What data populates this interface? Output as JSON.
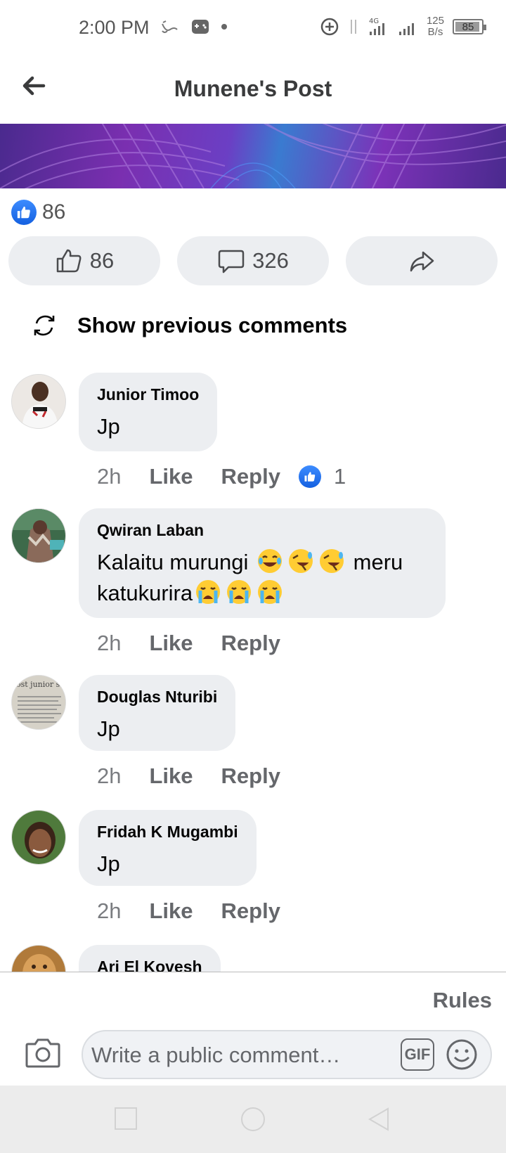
{
  "status_bar": {
    "time": "2:00 PM",
    "net_speed_value": "125",
    "net_speed_unit": "B/s",
    "network_type": "4G",
    "battery_level": "85"
  },
  "header": {
    "title": "Munene's Post"
  },
  "post": {
    "reaction_count": "86",
    "like_count": "86",
    "comment_count": "326"
  },
  "show_previous_label": "Show previous comments",
  "comments": [
    {
      "author": "Junior Timoo",
      "text": "Jp",
      "time": "2h",
      "like_label": "Like",
      "reply_label": "Reply",
      "reactions": "1"
    },
    {
      "author": "Qwiran Laban",
      "text_line1": "Kalaitu murungi",
      "text_line1_after": "meru",
      "text_line2": "katukurira",
      "time": "2h",
      "like_label": "Like",
      "reply_label": "Reply"
    },
    {
      "author": "Douglas Nturibi",
      "text": "Jp",
      "avatar_text": "ost junior secondary",
      "time": "2h",
      "like_label": "Like",
      "reply_label": "Reply"
    },
    {
      "author": "Fridah K Mugambi",
      "text": "Jp",
      "time": "2h",
      "like_label": "Like",
      "reply_label": "Reply"
    },
    {
      "author": "Ari El Kovesh"
    }
  ],
  "composer": {
    "rules_label": "Rules",
    "placeholder": "Write a public comment…",
    "gif_label": "GIF"
  },
  "colors": {
    "like_blue": "#1877f2",
    "pill_bg": "#eceef1",
    "secondary_text": "#65676b"
  }
}
